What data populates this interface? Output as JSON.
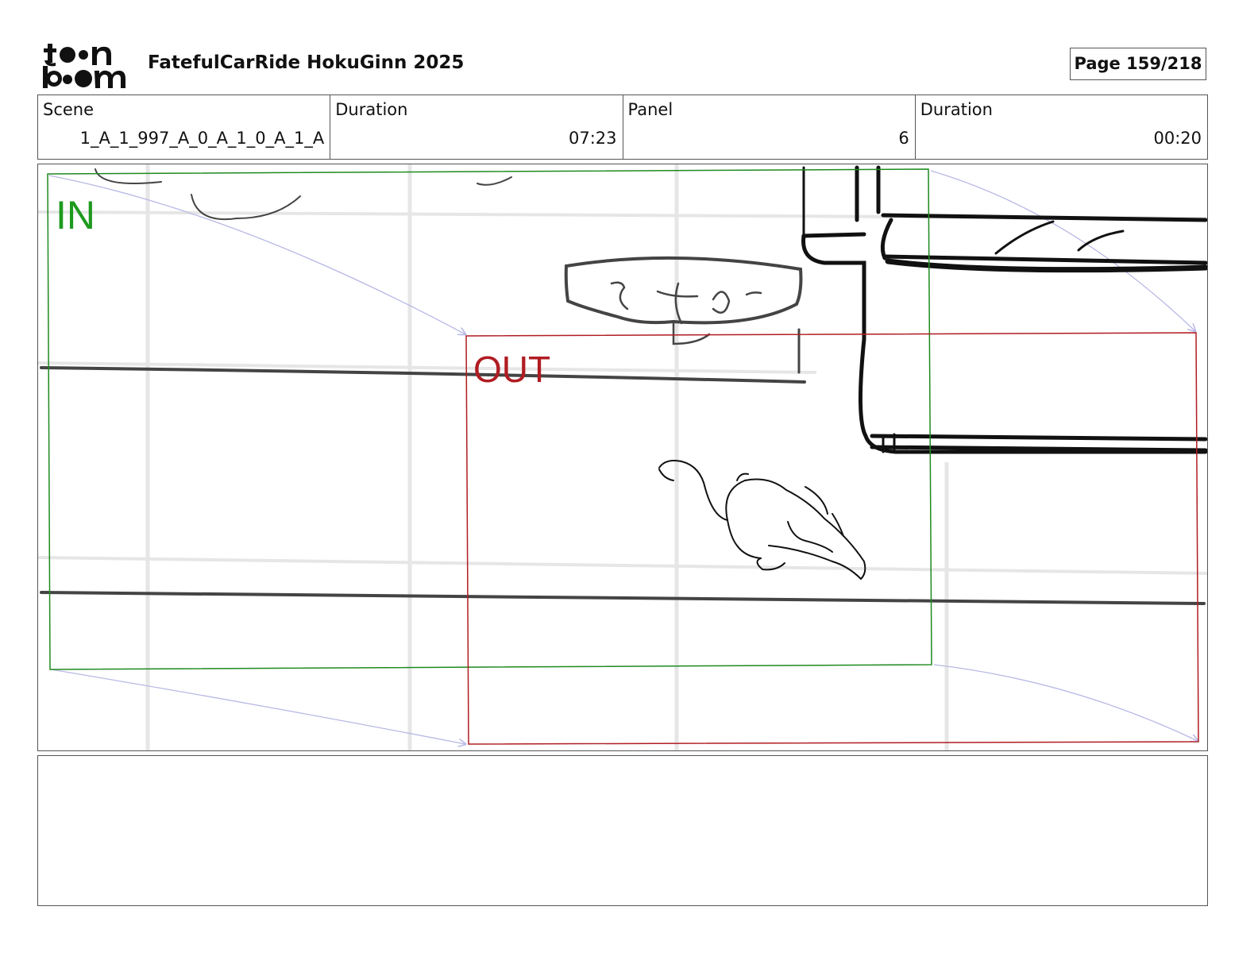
{
  "header": {
    "logo_line1": "toon",
    "logo_line2": "boom",
    "project_title": "FatefulCarRide HokuGinn 2025",
    "page_indicator": "Page 159/218"
  },
  "info": {
    "scene_label": "Scene",
    "scene_value": "1_A_1_997_A_0_A_1_0_A_1_A",
    "scene_duration_label": "Duration",
    "scene_duration_value": "07:23",
    "panel_label": "Panel",
    "panel_value": "6",
    "panel_duration_label": "Duration",
    "panel_duration_value": "00:20"
  },
  "panel": {
    "in_label": "IN",
    "out_label": "OUT",
    "in_color": "#1e8a1e",
    "out_color": "#b01c22",
    "arrow_color": "#b8b8e6"
  },
  "notes": {}
}
